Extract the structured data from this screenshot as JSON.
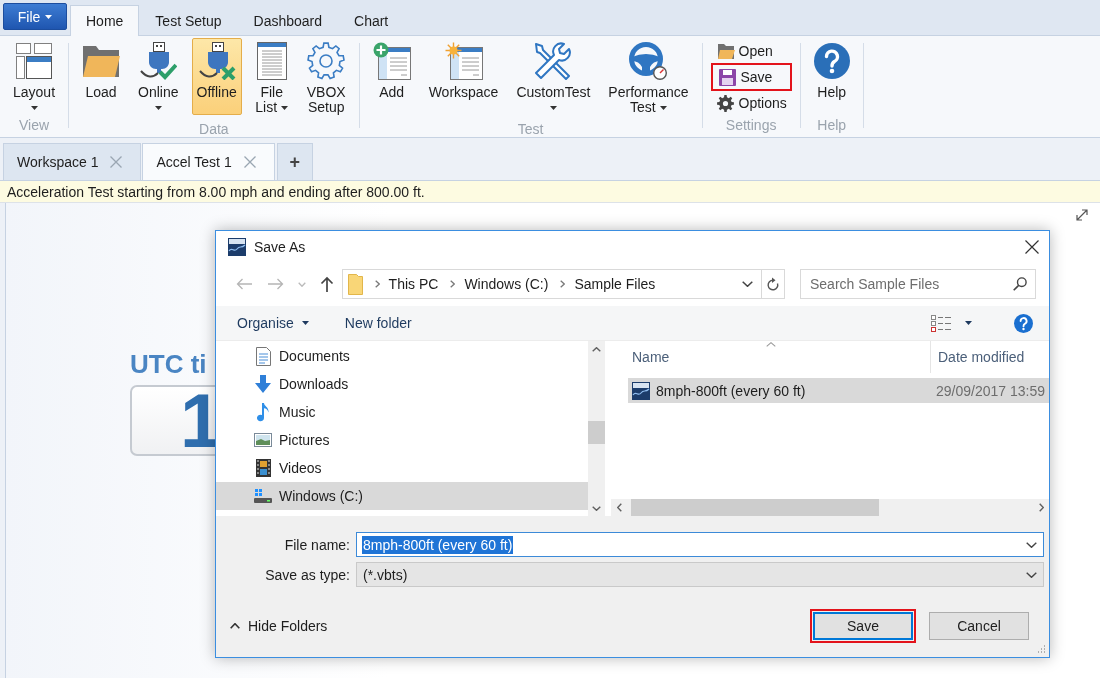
{
  "menu_bar": {
    "file_button": "File",
    "tabs": [
      {
        "label": "Home",
        "selected": true
      },
      {
        "label": "Test Setup",
        "selected": false
      },
      {
        "label": "Dashboard",
        "selected": false
      },
      {
        "label": "Chart",
        "selected": false
      }
    ]
  },
  "ribbon": {
    "groups": [
      {
        "label": "View",
        "items": [
          {
            "kind": "large",
            "label_lines": [
              "Layout"
            ],
            "has_menu": true,
            "active": false,
            "highlighted": false
          }
        ]
      },
      {
        "label": "Data",
        "items": [
          {
            "kind": "large",
            "label_lines": [
              "Load"
            ],
            "has_menu": false,
            "active": false,
            "highlighted": false
          },
          {
            "kind": "large",
            "label_lines": [
              "Online"
            ],
            "has_menu": true,
            "active": false,
            "highlighted": false
          },
          {
            "kind": "large",
            "label_lines": [
              "Offline"
            ],
            "has_menu": false,
            "active": true,
            "highlighted": false
          },
          {
            "kind": "large",
            "label_lines": [
              "File",
              "List"
            ],
            "has_menu": true,
            "active": false,
            "highlighted": false
          },
          {
            "kind": "large",
            "label_lines": [
              "VBOX",
              "Setup"
            ],
            "has_menu": false,
            "active": false,
            "highlighted": false
          }
        ]
      },
      {
        "label": "Test",
        "items": [
          {
            "kind": "large",
            "label_lines": [
              "Add"
            ],
            "has_menu": false,
            "active": false,
            "highlighted": false
          },
          {
            "kind": "large",
            "label_lines": [
              "Workspace"
            ],
            "has_menu": false,
            "active": false,
            "highlighted": false
          },
          {
            "kind": "large",
            "label_lines": [
              "CustomTest"
            ],
            "has_menu": true,
            "active": false,
            "highlighted": false
          },
          {
            "kind": "large",
            "label_lines": [
              "Performance",
              "Test"
            ],
            "has_menu": true,
            "active": false,
            "highlighted": false
          }
        ]
      },
      {
        "label": "Settings",
        "items": [
          {
            "kind": "small",
            "label_lines": [
              "Open"
            ],
            "has_menu": false,
            "active": false,
            "highlighted": false
          },
          {
            "kind": "small",
            "label_lines": [
              "Save"
            ],
            "has_menu": false,
            "active": false,
            "highlighted": true
          },
          {
            "kind": "small",
            "label_lines": [
              "Options"
            ],
            "has_menu": false,
            "active": false,
            "highlighted": false
          }
        ]
      },
      {
        "label": "Help",
        "items": [
          {
            "kind": "large",
            "label_lines": [
              "Help"
            ],
            "has_menu": false,
            "active": false,
            "highlighted": false
          }
        ]
      }
    ]
  },
  "document_tabs": {
    "tabs": [
      {
        "label": "Workspace 1",
        "selected": false
      },
      {
        "label": "Accel Test 1",
        "selected": true
      }
    ],
    "new_tab_button": "+"
  },
  "info_bar": "Acceleration Test starting from 8.00 mph and ending after 800.00 ft.",
  "workspace": {
    "heading": "UTC ti",
    "value": "1"
  },
  "save_dialog": {
    "title": "Save As",
    "address_bar": {
      "breadcrumbs": [
        "This PC",
        "Windows (C:)",
        "Sample Files"
      ]
    },
    "search": {
      "placeholder": "Search Sample Files"
    },
    "toolbar": {
      "organise_button": "Organise",
      "new_folder_button": "New folder"
    },
    "navigation_pane": [
      {
        "label": "Documents",
        "selected": false
      },
      {
        "label": "Downloads",
        "selected": false
      },
      {
        "label": "Music",
        "selected": false
      },
      {
        "label": "Pictures",
        "selected": false
      },
      {
        "label": "Videos",
        "selected": false
      },
      {
        "label": "Windows (C:)",
        "selected": true
      }
    ],
    "file_list": {
      "columns": [
        "Name",
        "Date modified"
      ],
      "rows": [
        {
          "name": "8mph-800ft (every 60 ft)",
          "date_modified": "29/09/2017 13:59",
          "selected": true
        }
      ]
    },
    "file_name": {
      "label": "File name:",
      "value": "8mph-800ft (every 60 ft)",
      "text_selected": true
    },
    "save_as_type": {
      "label": "Save as type:",
      "value": "(*.vbts)"
    },
    "hide_folders_button": "Hide Folders",
    "buttons": [
      {
        "label": "Save",
        "default": true,
        "highlighted": true
      },
      {
        "label": "Cancel",
        "default": false,
        "highlighted": false
      }
    ]
  }
}
